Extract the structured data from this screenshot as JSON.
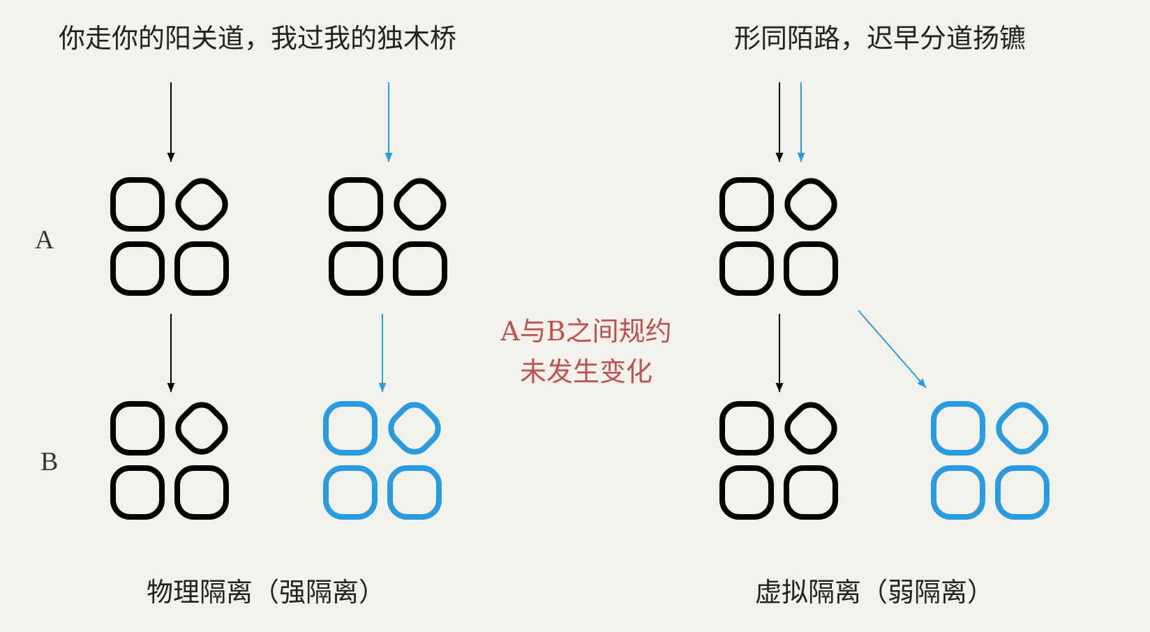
{
  "titles": {
    "left": "你走你的阳关道，我过我的独木桥",
    "right": "形同陌路，迟早分道扬镳"
  },
  "row_labels": {
    "a": "A",
    "b": "B"
  },
  "note": {
    "line1": "A与B之间规约",
    "line2": "未发生变化"
  },
  "captions": {
    "left": "物理隔离（强隔离）",
    "right": "虚拟隔离（弱隔离）"
  },
  "colors": {
    "black": "#000000",
    "blue": "#2b9be0",
    "note_red": "#c0504d",
    "background": "#f3f1ec"
  }
}
